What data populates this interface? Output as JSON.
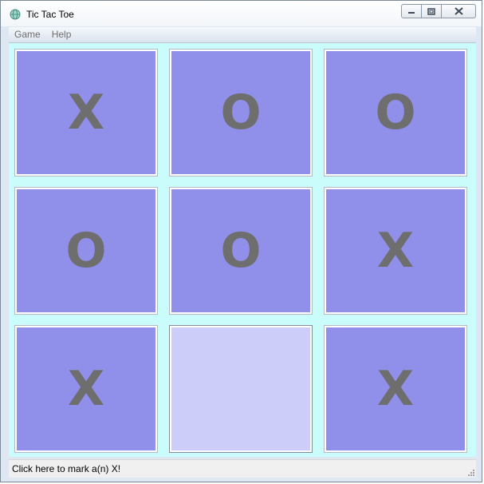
{
  "window": {
    "title": "Tic Tac Toe",
    "icon": "globe-icon"
  },
  "caption_buttons": {
    "minimize_icon": "minimize-icon",
    "maximize_icon": "maximize-icon",
    "close_icon": "close-icon"
  },
  "menu": {
    "items": [
      "Game",
      "Help"
    ]
  },
  "board": {
    "cells": [
      [
        "X",
        "O",
        "O"
      ],
      [
        "O",
        "O",
        "X"
      ],
      [
        "X",
        "",
        "X"
      ]
    ],
    "hover_cell": {
      "row": 2,
      "col": 1
    }
  },
  "status": {
    "text": "Click here to mark a(n) X!"
  },
  "colors": {
    "board_background": "#c9fcfa",
    "cell_fill": "#9090ea",
    "cell_hover_fill": "#cdcdfa",
    "mark_color": "#6e6e6e"
  }
}
